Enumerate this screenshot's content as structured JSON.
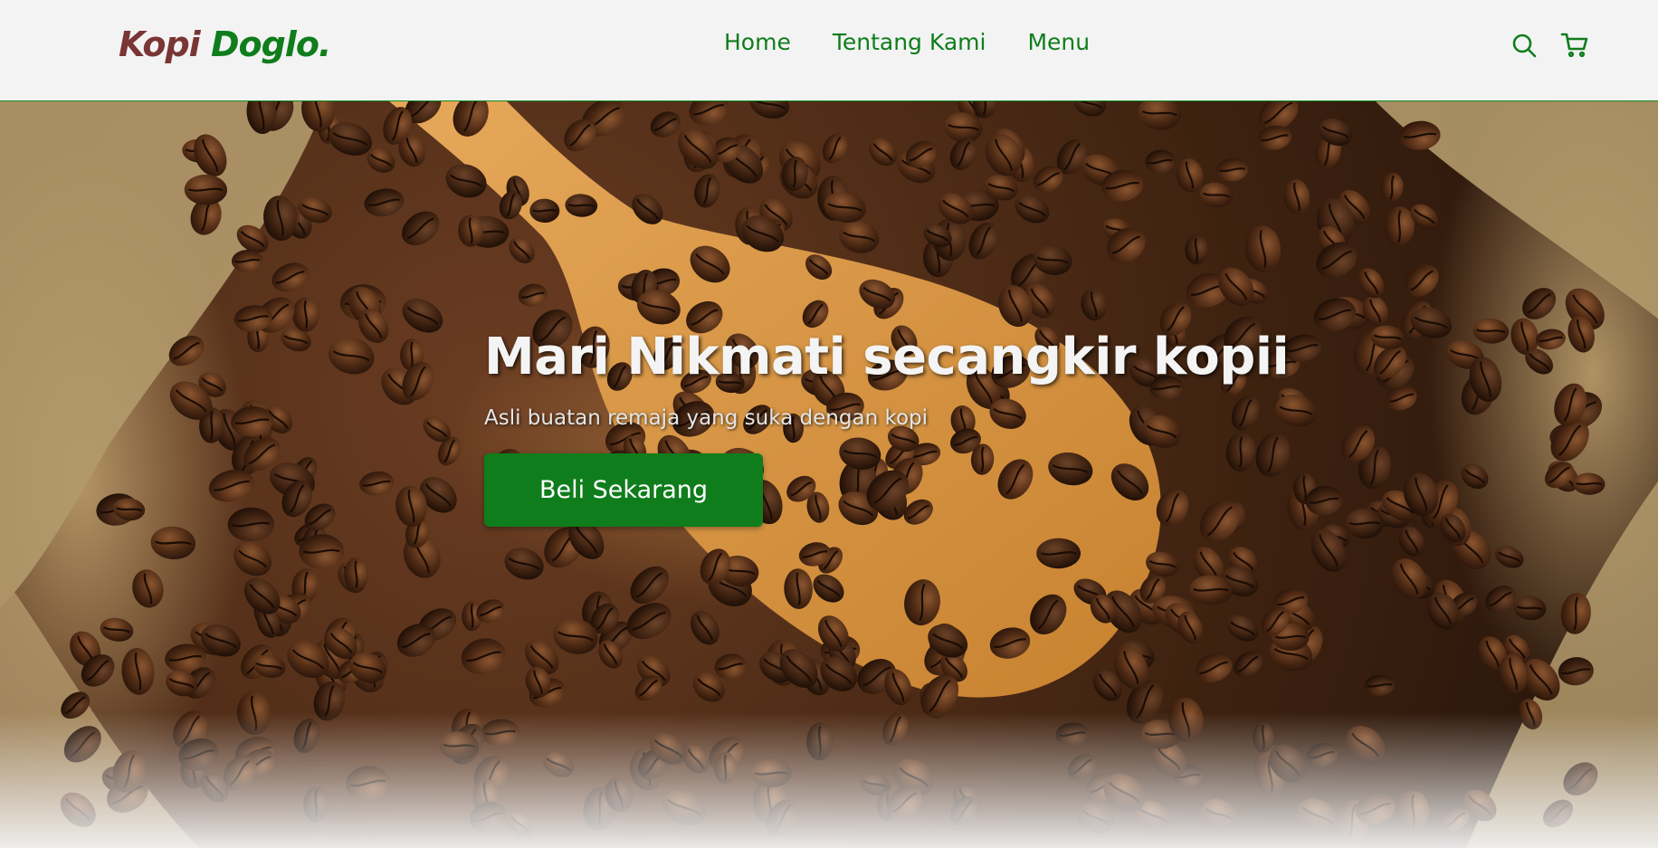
{
  "brand": {
    "part1": "Kopi",
    "part2": "Doglo.",
    "color_part1": "#7a3535",
    "color_part2": "#0f7d1c"
  },
  "nav": {
    "links": [
      "Home",
      "Tentang Kami",
      "Menu"
    ],
    "icons": [
      "search-icon",
      "cart-icon"
    ]
  },
  "hero": {
    "title": "Mari Nikmati secangkir kopii",
    "subtitle": "Asli buatan remaja yang suka dengan kopi",
    "cta_label": "Beli Sekarang",
    "background": "coffee-beans-wooden-spoon-image"
  },
  "colors": {
    "accent": "#0f7d1c",
    "navbar_bg": "#f3f3f3"
  }
}
